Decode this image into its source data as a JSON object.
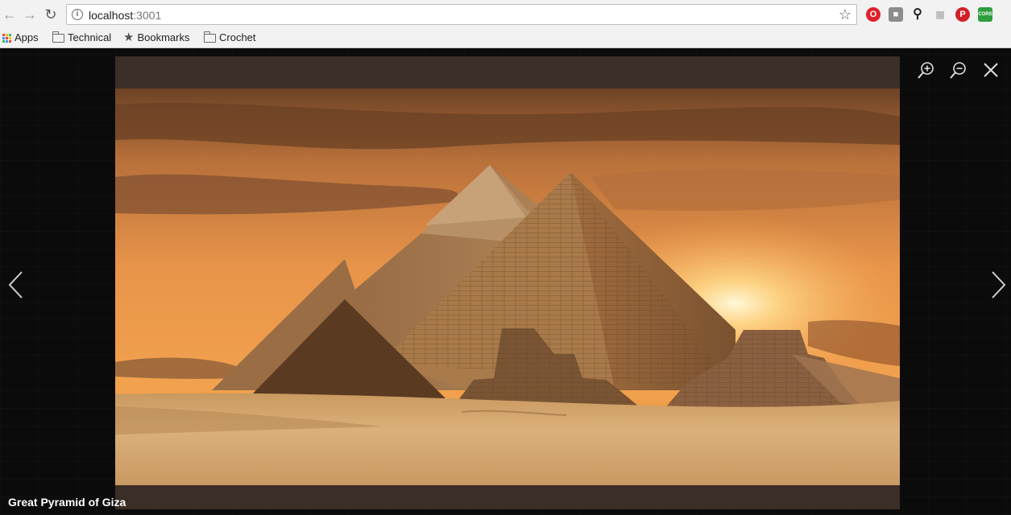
{
  "browser": {
    "url_host": "localhost",
    "url_port": ":3001",
    "bookmarks": [
      {
        "label": "Apps"
      },
      {
        "label": "Technical"
      },
      {
        "label": "Bookmarks"
      },
      {
        "label": "Crochet"
      }
    ],
    "extension_icons": [
      "opera-icon",
      "pocket-icon",
      "search-icon",
      "stats-icon",
      "pinterest-icon",
      "cors-icon"
    ],
    "extension_cors_label": "CORS"
  },
  "viewer": {
    "caption": "Great Pyramid of Giza",
    "controls": [
      "zoom-in-icon",
      "zoom-out-icon",
      "close-icon"
    ],
    "nav": [
      "previous-arrow-icon",
      "next-arrow-icon"
    ]
  },
  "colors": {
    "sky_top": "#7a4a2a",
    "sky_glow": "#f0a050",
    "sun": "#fff4c8",
    "sand": "#d7a86e",
    "pyramid": "#a87a4f"
  }
}
